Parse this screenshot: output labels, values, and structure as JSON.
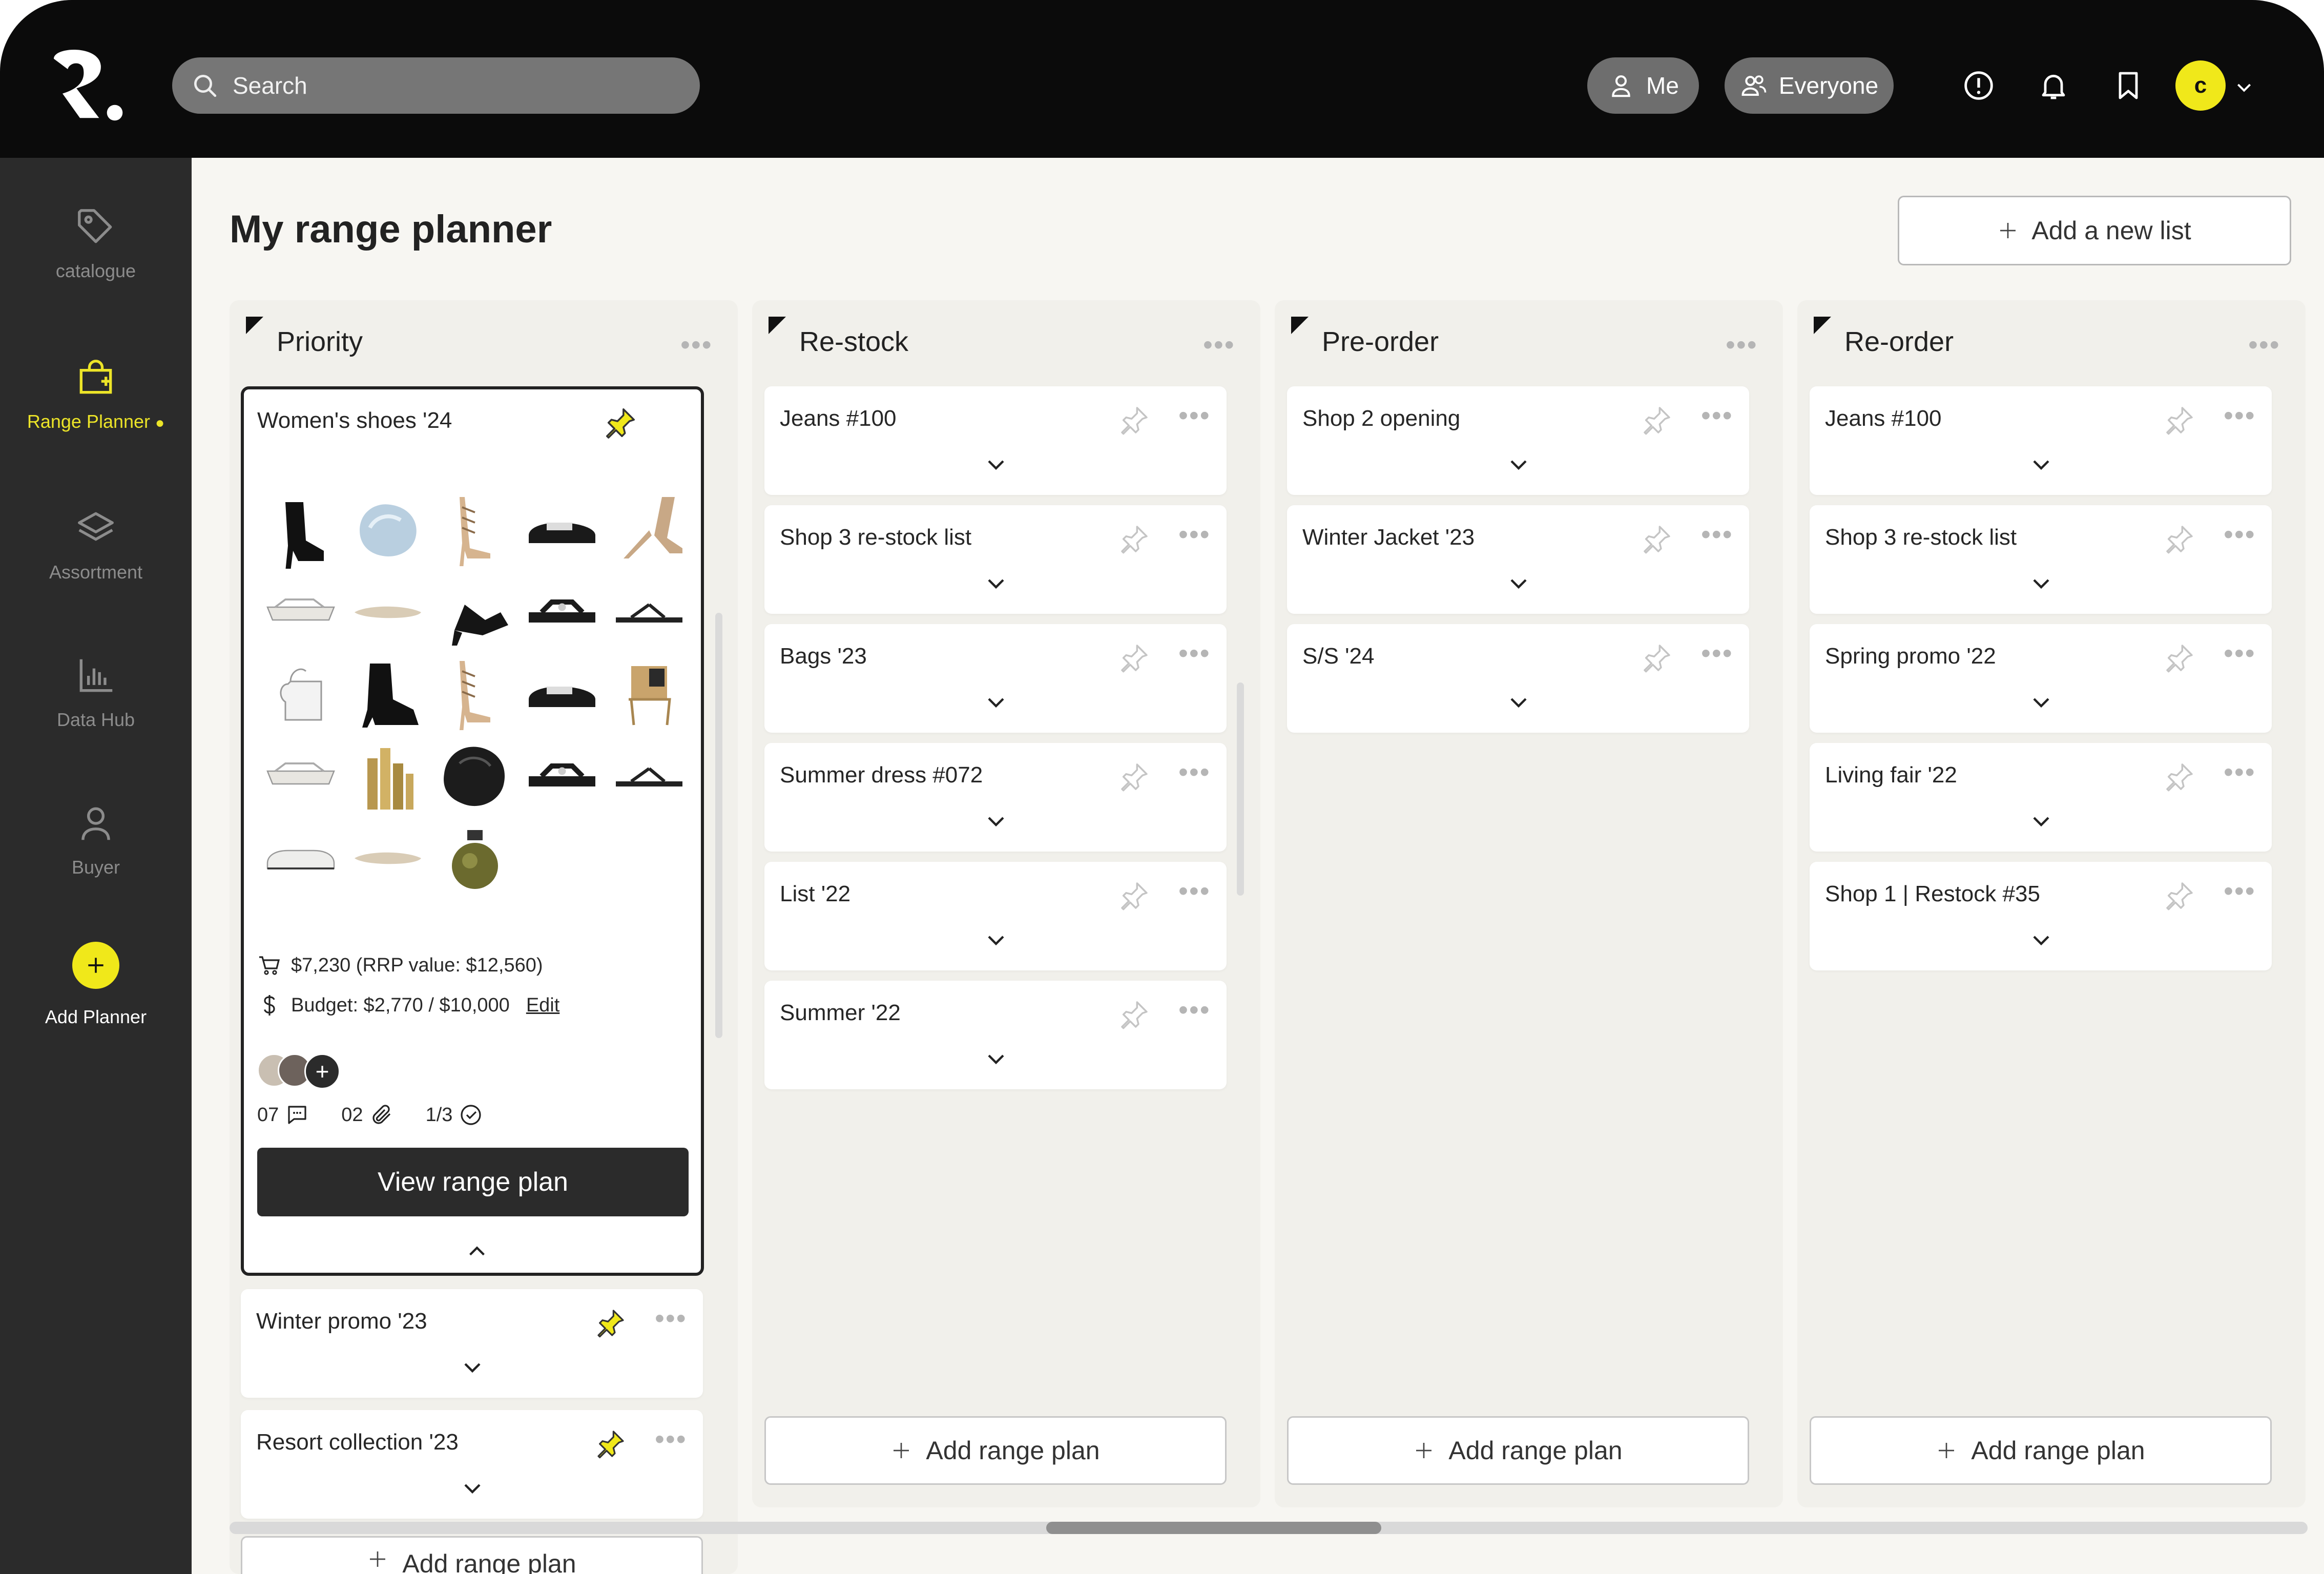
{
  "search": {
    "placeholder": "Search"
  },
  "header": {
    "me_label": "Me",
    "everyone_label": "Everyone",
    "avatar_initial": "c"
  },
  "sidebar": {
    "items": [
      {
        "label": "catalogue",
        "icon": "tag-icon"
      },
      {
        "label": "Range Planner",
        "icon": "shopping-bag-plus-icon",
        "active": true
      },
      {
        "label": "Assortment",
        "icon": "layers-icon"
      },
      {
        "label": "Data Hub",
        "icon": "bar-chart-icon"
      },
      {
        "label": "Buyer",
        "icon": "user-icon"
      }
    ],
    "add_label": "Add Planner"
  },
  "page": {
    "title": "My range planner",
    "add_list_label": "Add a new list"
  },
  "columns": [
    {
      "title": "Priority",
      "expanded_card": {
        "title": "Women's shoes '24",
        "price_text": "$7,230 (RRP value: $12,560)",
        "budget_text": "Budget: $2,770 / $10,000",
        "edit_label": "Edit",
        "comments": "07",
        "attachments": "02",
        "tasks": "1/3",
        "view_label": "View range plan"
      },
      "cards": [
        {
          "title": "Winter promo '23"
        },
        {
          "title": "Resort collection '23"
        }
      ],
      "add_label": "Add range plan"
    },
    {
      "title": "Re-stock",
      "cards": [
        {
          "title": "Jeans #100"
        },
        {
          "title": "Shop 3 re-stock list"
        },
        {
          "title": "Bags '23"
        },
        {
          "title": "Summer dress #072"
        },
        {
          "title": "List '22"
        },
        {
          "title": "Summer '22"
        }
      ],
      "add_label": "Add range plan"
    },
    {
      "title": "Pre-order",
      "cards": [
        {
          "title": "Shop 2 opening"
        },
        {
          "title": "Winter Jacket '23"
        },
        {
          "title": "S/S '24"
        }
      ],
      "add_label": "Add range plan"
    },
    {
      "title": "Re-order",
      "cards": [
        {
          "title": "Jeans #100"
        },
        {
          "title": "Shop 3 re-stock list"
        },
        {
          "title": "Spring promo '22"
        },
        {
          "title": "Living fair '22"
        },
        {
          "title": "Shop 1 | Restock #35"
        }
      ],
      "add_label": "Add range plan"
    }
  ],
  "colors": {
    "accent": "#f0e81a",
    "topbar": "#0b0b0b",
    "sidebar": "#2b2b2b"
  }
}
